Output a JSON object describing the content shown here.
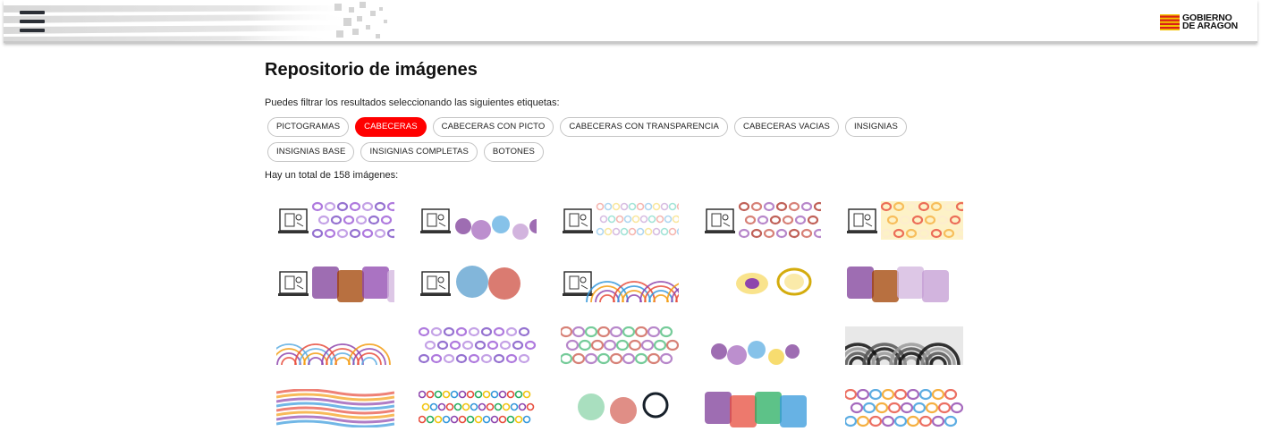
{
  "header": {
    "menu_icon": "hamburger-menu-icon",
    "logo": {
      "line1": "GOBIERNO",
      "line2": "DE ARAGON",
      "flag_colors": [
        "#f4c300",
        "#d91e18"
      ]
    }
  },
  "page": {
    "title": "Repositorio de imágenes",
    "filter_intro": "Puedes filtrar los resultados seleccionando las siguientes etiquetas:",
    "total_text": "Hay un total de 158 imágenes:"
  },
  "tags": [
    {
      "label": "PICTOGRAMAS",
      "active": false
    },
    {
      "label": "CABECERAS",
      "active": true
    },
    {
      "label": "CABECERAS CON PICTO",
      "active": false
    },
    {
      "label": "CABECERAS CON TRANSPARENCIA",
      "active": false
    },
    {
      "label": "CABECERAS VACIAS",
      "active": false
    },
    {
      "label": "INSIGNIAS",
      "active": false
    },
    {
      "label": "INSIGNIAS BASE",
      "active": false
    },
    {
      "label": "INSIGNIAS COMPLETAS",
      "active": false
    },
    {
      "label": "BOTONES",
      "active": false
    }
  ],
  "colors": {
    "accent": "#ff0000",
    "header_border": "#c9c9c9"
  },
  "images": [
    {
      "style": "picto-rings",
      "palette": [
        "#9b59d6",
        "#b58be0",
        "#7a4fc4"
      ]
    },
    {
      "style": "picto-blobs",
      "palette": [
        "#7d3c98",
        "#a569bd",
        "#5dade2",
        "#c39bd3"
      ]
    },
    {
      "style": "picto-dots",
      "palette": [
        "#f5b7b1",
        "#aed6f1",
        "#f9e79f",
        "#d7bde2",
        "#a3e4d7"
      ]
    },
    {
      "style": "picto-rings",
      "palette": [
        "#b03a2e",
        "#cd6155",
        "#a569bd"
      ]
    },
    {
      "style": "picto-rings-yellow",
      "palette": [
        "#e74c3c",
        "#f5b041",
        "#fdebd0"
      ]
    },
    {
      "style": "picto-squares",
      "palette": [
        "#7d3c98",
        "#a04000",
        "#8e44ad",
        "#d2b4de"
      ]
    },
    {
      "style": "picto-blobs-big",
      "palette": [
        "#2e86c1",
        "#cb4335",
        "#d5dbdb"
      ]
    },
    {
      "style": "picto-arcs",
      "palette": [
        "#e74c3c",
        "#8e44ad",
        "#f39c12",
        "#3498db"
      ]
    },
    {
      "style": "ovals",
      "palette": [
        "#f7dc6f",
        "#8e44ad",
        "#1f618d",
        "#d4ac0d"
      ]
    },
    {
      "style": "squares",
      "palette": [
        "#7d3c98",
        "#a04000",
        "#d2b4de",
        "#c39bd3"
      ]
    },
    {
      "style": "arcs",
      "palette": [
        "#e74c3c",
        "#8e44ad",
        "#f39c12",
        "#5dade2"
      ]
    },
    {
      "style": "rings",
      "palette": [
        "#9b59d6",
        "#b58be0",
        "#7a4fc4"
      ]
    },
    {
      "style": "rings-pink",
      "palette": [
        "#cd6155",
        "#a569bd",
        "#52be80"
      ]
    },
    {
      "style": "blobs",
      "palette": [
        "#7d3c98",
        "#a569bd",
        "#5dade2",
        "#f4d03f"
      ]
    },
    {
      "style": "gray-arcs",
      "palette": [
        "#111111",
        "#555555",
        "#999999"
      ]
    },
    {
      "style": "waves",
      "palette": [
        "#e74c3c",
        "#f39c12",
        "#8e44ad",
        "#3498db"
      ]
    },
    {
      "style": "small-dots",
      "palette": [
        "#8e44ad",
        "#e74c3c",
        "#27ae60",
        "#f1c40f",
        "#3498db"
      ]
    },
    {
      "style": "blobs-green",
      "palette": [
        "#27ae60",
        "#cb4335",
        "#17202a",
        "#d5dbdb"
      ]
    },
    {
      "style": "squares-multi",
      "palette": [
        "#7d3c98",
        "#e74c3c",
        "#27ae60",
        "#3498db"
      ]
    },
    {
      "style": "rings-colored",
      "palette": [
        "#e74c3c",
        "#8e44ad",
        "#3498db",
        "#f39c12"
      ]
    }
  ]
}
